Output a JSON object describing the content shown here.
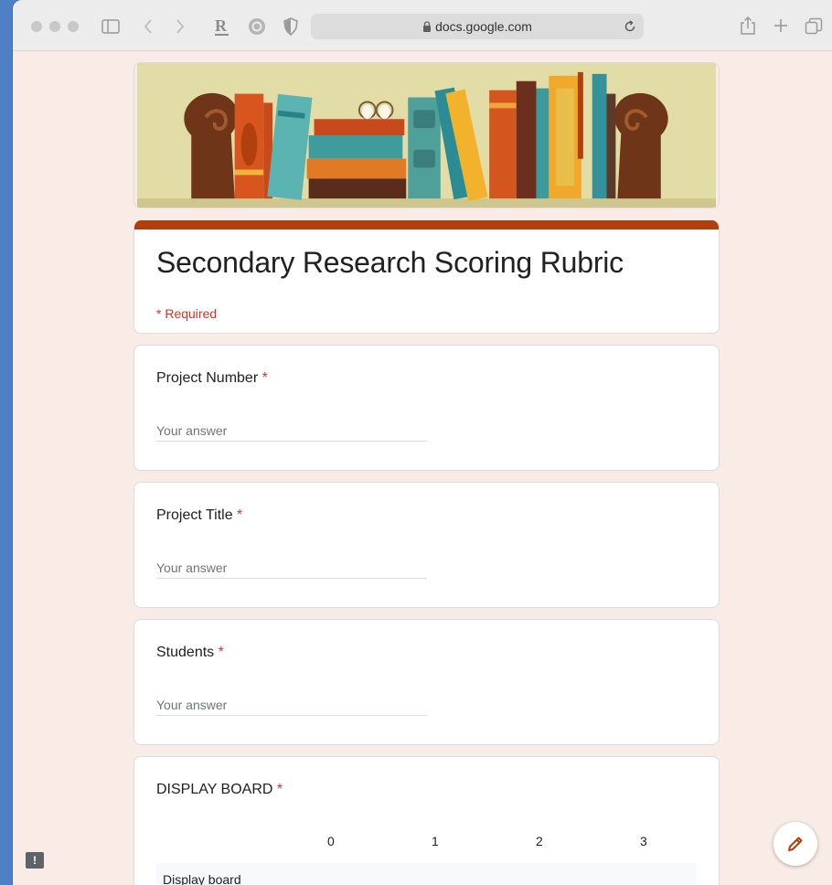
{
  "browser": {
    "url": "docs.google.com"
  },
  "form": {
    "title": "Secondary Research Scoring Rubric",
    "required_note": "* Required",
    "accent_color": "#b23f0b",
    "questions": [
      {
        "label": "Project Number",
        "required_mark": "*",
        "placeholder": "Your answer"
      },
      {
        "label": "Project Title",
        "required_mark": "*",
        "placeholder": "Your answer"
      },
      {
        "label": "Students",
        "required_mark": "*",
        "placeholder": "Your answer"
      }
    ],
    "grid_question": {
      "label": "DISPLAY BOARD",
      "required_mark": "*",
      "columns": [
        "0",
        "1",
        "2",
        "3"
      ],
      "rows": [
        "Display board"
      ]
    }
  },
  "icons": {
    "fab": "pencil-icon",
    "feedback": "report-issue-icon",
    "lock": "lock-icon"
  }
}
